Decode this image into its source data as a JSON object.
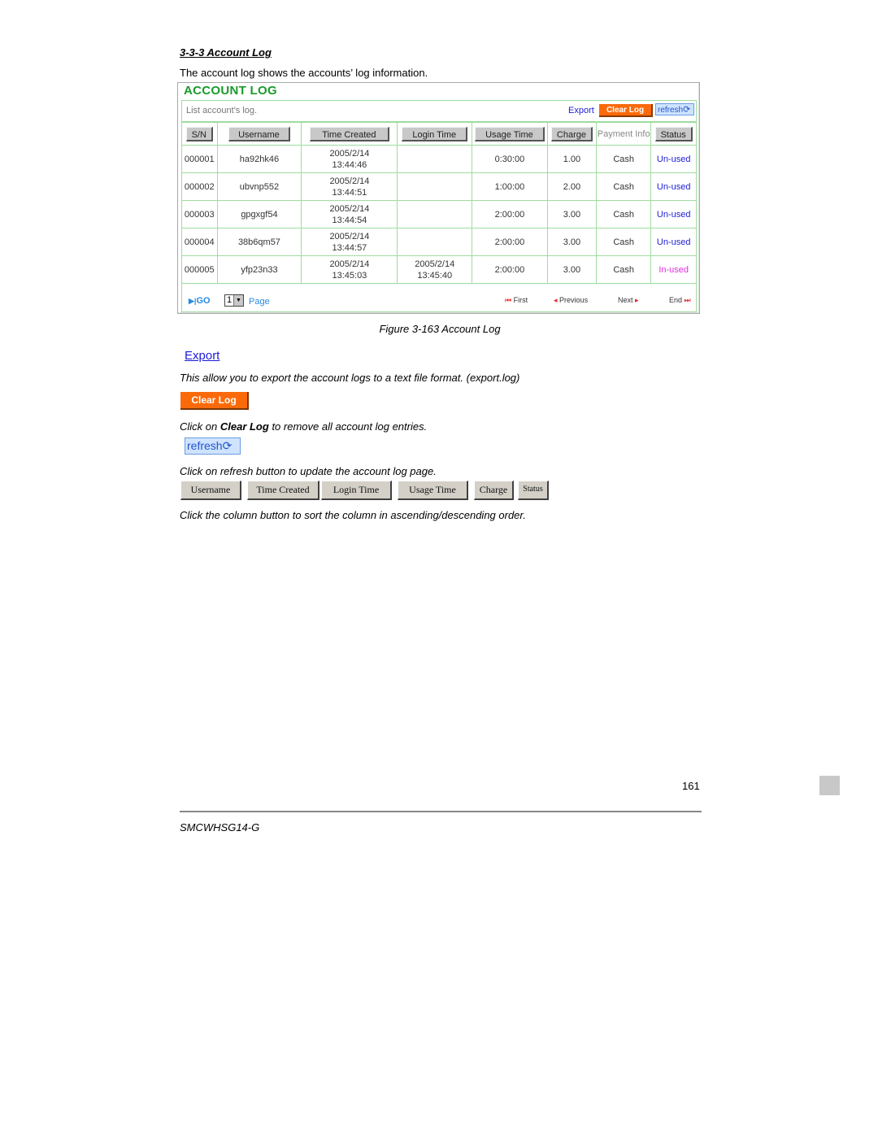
{
  "section": {
    "title": "3-3-3 Account Log",
    "intro": "The account log shows the accounts’ log information."
  },
  "figure": {
    "heading": "ACCOUNT LOG",
    "toolbar": {
      "description": "List account's log.",
      "export_label": "Export",
      "clear_label": "Clear Log",
      "refresh_label": "refresh"
    },
    "columns": [
      "S/N",
      "Username",
      "Time Created",
      "Login Time",
      "Usage Time",
      "Charge",
      "Payment Info",
      "Status"
    ],
    "rows": [
      {
        "sn": "000001",
        "username": "ha92hk46",
        "created_date": "2005/2/14",
        "created_time": "13:44:46",
        "login_date": "",
        "login_time": "",
        "usage": "0:30:00",
        "charge": "1.00",
        "payment": "Cash",
        "status": "Un-used"
      },
      {
        "sn": "000002",
        "username": "ubvnp552",
        "created_date": "2005/2/14",
        "created_time": "13:44:51",
        "login_date": "",
        "login_time": "",
        "usage": "1:00:00",
        "charge": "2.00",
        "payment": "Cash",
        "status": "Un-used"
      },
      {
        "sn": "000003",
        "username": "gpgxgf54",
        "created_date": "2005/2/14",
        "created_time": "13:44:54",
        "login_date": "",
        "login_time": "",
        "usage": "2:00:00",
        "charge": "3.00",
        "payment": "Cash",
        "status": "Un-used"
      },
      {
        "sn": "000004",
        "username": "38b6qm57",
        "created_date": "2005/2/14",
        "created_time": "13:44:57",
        "login_date": "",
        "login_time": "",
        "usage": "2:00:00",
        "charge": "3.00",
        "payment": "Cash",
        "status": "Un-used"
      },
      {
        "sn": "000005",
        "username": "yfp23n33",
        "created_date": "2005/2/14",
        "created_time": "13:45:03",
        "login_date": "2005/2/14",
        "login_time": "13:45:40",
        "usage": "2:00:00",
        "charge": "3.00",
        "payment": "Cash",
        "status": "In-used"
      }
    ],
    "pager": {
      "go_label": "GO",
      "page_value": "1",
      "page_label": "Page",
      "first_label": "First",
      "previous_label": "Previous",
      "next_label": "Next",
      "end_label": "End"
    },
    "caption": "Figure 3-163 Account Log"
  },
  "body": {
    "export_link": "Export",
    "export_desc": "This allow you to export the account logs to a text file format. (export.log)",
    "clear_button": "Clear Log",
    "clear_desc_prefix": "Click on ",
    "clear_desc_bold": "Clear Log",
    "clear_desc_suffix": " to remove all account log entries.",
    "refresh_button": "refresh",
    "refresh_desc": "Click on refresh button to update the account log page.",
    "sort_buttons": [
      "Username",
      "Time Created",
      "Login Time",
      "Usage Time",
      "Charge",
      "Status"
    ],
    "sort_desc": "Click the column button to sort the column in ascending/descending order."
  },
  "footer": {
    "page_number": "161",
    "model": "SMCWHSG14-G"
  },
  "colors": {
    "heading_green": "#1a9a2b",
    "clear_orange": "#fb6a0a",
    "link_blue": "#1b1bdc",
    "unused_blue": "#2020d8",
    "inused_magenta": "#e030e0"
  }
}
